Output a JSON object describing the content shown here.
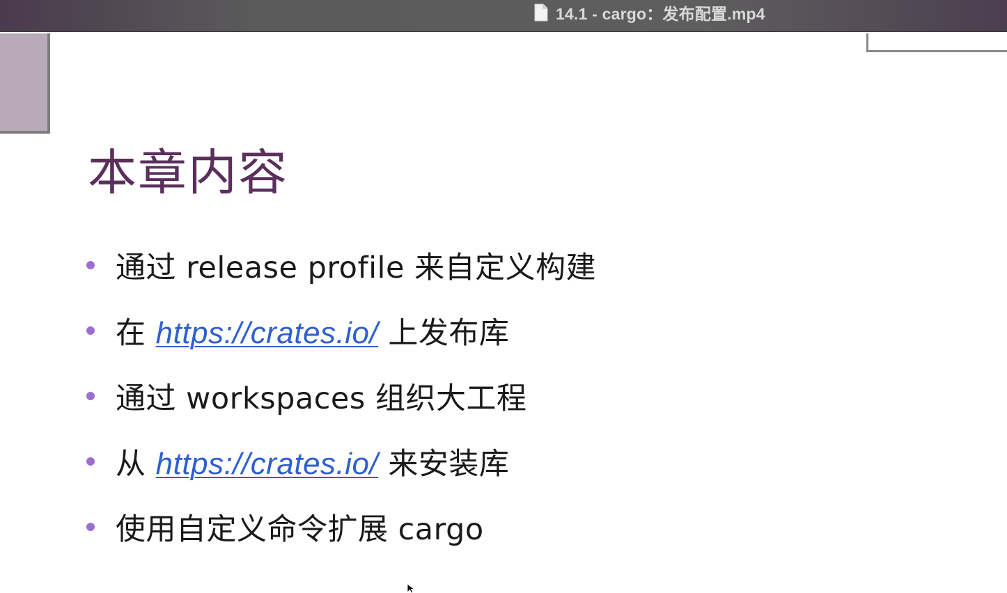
{
  "window": {
    "title": "14.1 - cargo：发布配置.mp4",
    "file_icon": "document-icon"
  },
  "slide": {
    "heading": "本章内容",
    "accent_color": "#5a2f5c",
    "bullet_color": "#9b6fd0",
    "link_color": "#2f5fd0",
    "bullets": [
      {
        "pre": "通过 release profile 来自定义构建",
        "link": "",
        "post": ""
      },
      {
        "pre": "在 ",
        "link": "https://crates.io/",
        "post": " 上发布库"
      },
      {
        "pre": "通过 workspaces 组织大工程",
        "link": "",
        "post": ""
      },
      {
        "pre": "从 ",
        "link": "https://crates.io/",
        "post": " 来安装库"
      },
      {
        "pre": "使用自定义命令扩展 cargo",
        "link": "",
        "post": ""
      }
    ]
  }
}
